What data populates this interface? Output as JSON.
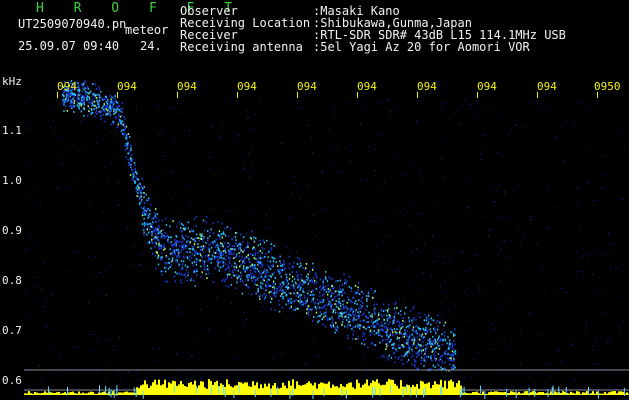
{
  "header": {
    "title": "H R O F F T",
    "filename": "UT2509070940.pn",
    "meteor_label": "meteor",
    "date_time": "25.09.07 09:40",
    "count": "24.",
    "info_labels": [
      "Observer",
      "Receiving Location",
      "Receiver",
      "Receiving antenna"
    ],
    "info_values": [
      ":Masaki Kano",
      ":Shibukawa,Gunma,Japan",
      ":RTL-SDR SDR# 43dB L15 114.1MHz USB",
      ":5el Yagi Az 20 for Aomori VOR"
    ]
  },
  "axes": {
    "y_unit": "kHz",
    "y_ticks": [
      "1.1",
      "1.0",
      "0.9",
      "0.8",
      "0.7",
      "0.6"
    ],
    "x_ticks": [
      "094",
      "094",
      "094",
      "094",
      "094",
      "094",
      "094",
      "094",
      "094",
      "0950"
    ]
  },
  "colors": {
    "background": "#000000",
    "tick_text": "#f2f200",
    "signal_low": "#1a3ad8",
    "signal_mid": "#27c0ff",
    "signal_high": "#b9ff6a",
    "noise_band": "#ffff00",
    "title": "#3fcf3f"
  }
}
